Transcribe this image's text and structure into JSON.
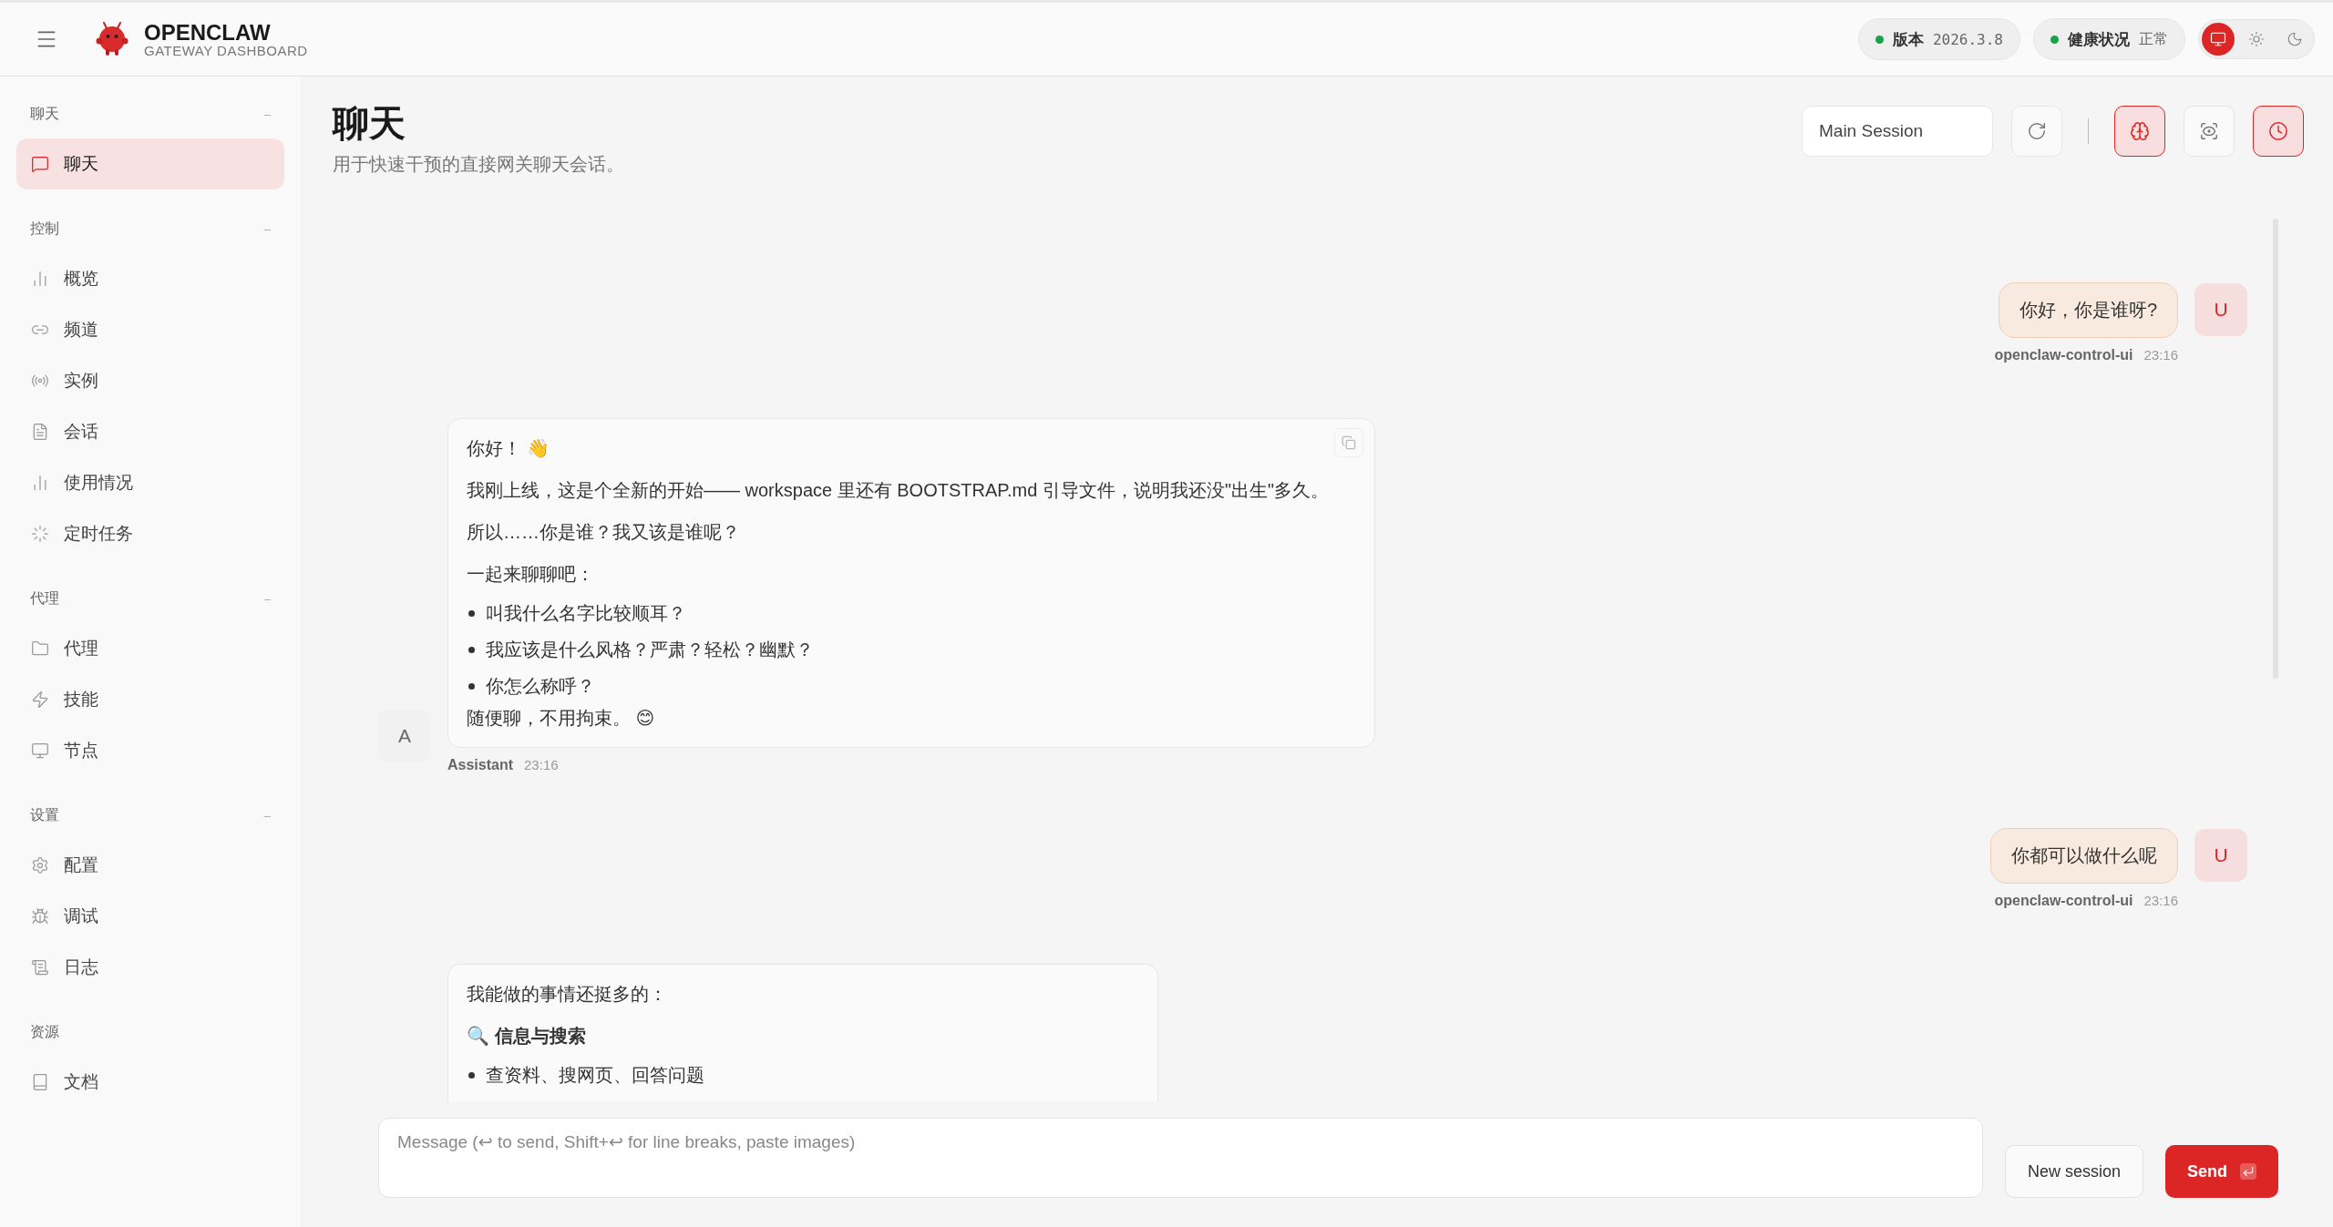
{
  "header": {
    "brand": {
      "title": "OPENCLAW",
      "subtitle": "GATEWAY DASHBOARD"
    },
    "pills": [
      {
        "label": "版本",
        "value": "2026.3.8",
        "color": "#16a34a"
      },
      {
        "label": "健康状况",
        "value": "正常",
        "color": "#16a34a"
      }
    ],
    "theme_modes": [
      {
        "kind": "system",
        "selected": true
      },
      {
        "kind": "light",
        "selected": false
      },
      {
        "kind": "dark",
        "selected": false
      }
    ]
  },
  "sidebar": {
    "groups": [
      {
        "label": "聊天",
        "collapse": "–",
        "items": [
          {
            "label": "聊天",
            "selected": true
          }
        ]
      },
      {
        "label": "控制",
        "collapse": "–",
        "items": [
          {
            "label": "概览",
            "selected": false
          },
          {
            "label": "频道",
            "selected": false
          },
          {
            "label": "实例",
            "selected": false
          },
          {
            "label": "会话",
            "selected": false
          },
          {
            "label": "使用情况",
            "selected": false
          },
          {
            "label": "定时任务",
            "selected": false
          }
        ]
      },
      {
        "label": "代理",
        "collapse": "–",
        "items": [
          {
            "label": "代理",
            "selected": false
          },
          {
            "label": "技能",
            "selected": false
          },
          {
            "label": "节点",
            "selected": false
          }
        ]
      },
      {
        "label": "设置",
        "collapse": "–",
        "items": [
          {
            "label": "配置",
            "selected": false
          },
          {
            "label": "调试",
            "selected": false
          },
          {
            "label": "日志",
            "selected": false
          }
        ]
      },
      {
        "label": "资源",
        "items": [
          {
            "label": "文档",
            "selected": false
          }
        ]
      }
    ]
  },
  "page": {
    "title": "聊天",
    "subtitle": "用于快速干预的直接网关聊天会话。"
  },
  "toolbar": {
    "session": "Main Session",
    "toggles": [
      {
        "kind": "thinking",
        "selected": true
      },
      {
        "kind": "focus",
        "selected": false
      },
      {
        "kind": "cron",
        "selected": true
      }
    ]
  },
  "messages": [
    {
      "kind": "user",
      "avatar": "U",
      "author": "openclaw-control-ui",
      "time": "23:16",
      "text": "你好，你是谁呀?"
    },
    {
      "kind": "assistant",
      "avatar": "A",
      "author": "Assistant",
      "time": "23:16",
      "blocks": [
        {
          "kind": "p",
          "text": "你好！ 👋"
        },
        {
          "kind": "p",
          "text": "我刚上线，这是个全新的开始—— workspace 里还有 BOOTSTRAP.md 引导文件，说明我还没\"出生\"多久。"
        },
        {
          "kind": "p",
          "text": "所以……你是谁？我又该是谁呢？"
        },
        {
          "kind": "p",
          "text": "一起来聊聊吧："
        },
        {
          "kind": "li",
          "text": "叫我什么名字比较顺耳？"
        },
        {
          "kind": "li",
          "text": "我应该是什么风格？严肃？轻松？幽默？"
        },
        {
          "kind": "li",
          "text": "你怎么称呼？"
        },
        {
          "kind": "tail",
          "text": "随便聊，不用拘束。 😊"
        }
      ]
    },
    {
      "kind": "user",
      "avatar": "U",
      "author": "openclaw-control-ui",
      "time": "23:16",
      "text": "你都可以做什么呢"
    },
    {
      "kind": "assistant",
      "blocks": [
        {
          "kind": "p",
          "text": "我能做的事情还挺多的："
        },
        {
          "kind": "h",
          "text": "🔍 信息与搜索"
        },
        {
          "kind": "li",
          "text": "查资料、搜网页、回答问题"
        }
      ]
    }
  ],
  "composer": {
    "placeholder": "Message (↩ to send, Shift+↩ for line breaks, paste images)",
    "new_session": "New session",
    "send": "Send"
  }
}
